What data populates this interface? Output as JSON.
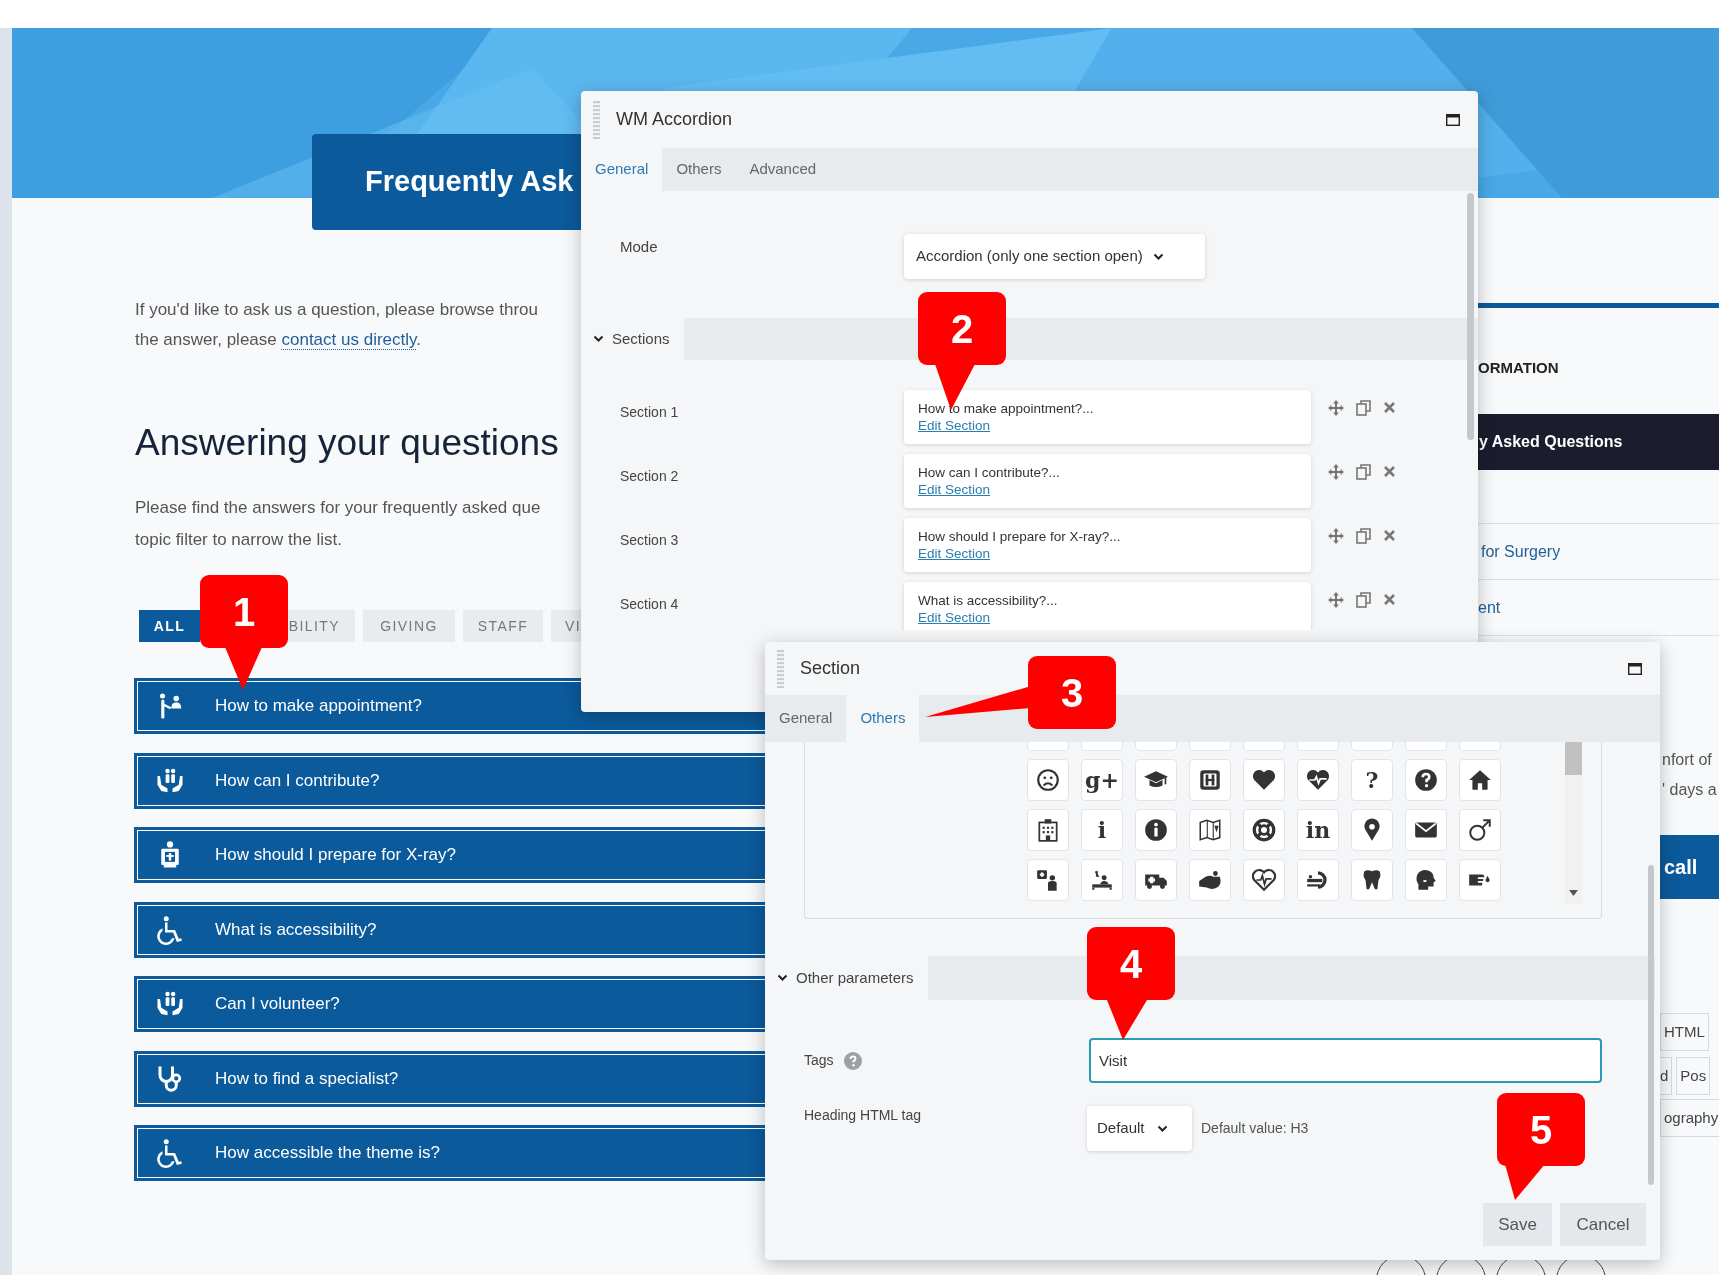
{
  "hero": {
    "title": "Frequently Ask"
  },
  "intro": {
    "line1": "If you'd like to ask us a question, please browse throu",
    "line2_start": "the answer, please ",
    "link": "contact us directly",
    "line2_end": "."
  },
  "heading": "Answering your questions",
  "description": {
    "lines": [
      "Please find the answers for your frequently asked que",
      "topic filter to narrow the list."
    ]
  },
  "filters": [
    {
      "label": "ALL",
      "selected": true
    },
    {
      "label": "BILITY",
      "selected": false
    },
    {
      "label": "GIVING",
      "selected": false
    },
    {
      "label": "STAFF",
      "selected": false
    },
    {
      "label": "VI",
      "selected": false
    }
  ],
  "faq": [
    {
      "question": "How to make appointment?"
    },
    {
      "question": "How can I contribute?"
    },
    {
      "question": "How should I prepare for X-ray?"
    },
    {
      "question": "What is accessibility?"
    },
    {
      "question": "Can I volunteer?"
    },
    {
      "question": "How to find a specialist?"
    },
    {
      "question": "How accessible the theme is?"
    }
  ],
  "sidebar": {
    "heading": "ORMATION",
    "active_item": "y Asked Questions",
    "links": [
      "for Surgery",
      "ent"
    ],
    "text_lines": [
      "nfort of",
      "' days a"
    ],
    "button": "call",
    "tags": [
      [
        "HTML"
      ],
      [
        "d",
        "Pos"
      ],
      [
        "ography"
      ]
    ]
  },
  "accordion_dialog": {
    "title": "WM Accordion",
    "tabs": [
      {
        "label": "General",
        "selected": true
      },
      {
        "label": "Others",
        "selected": false
      },
      {
        "label": "Advanced",
        "selected": false
      }
    ],
    "mode_label": "Mode",
    "mode_value": "Accordion (only one section open)",
    "group": "Sections",
    "sections": [
      {
        "label": "Section 1",
        "summary": "How to make appointment?...",
        "link": "Edit Section"
      },
      {
        "label": "Section 2",
        "summary": "How can I contribute?...",
        "link": "Edit Section"
      },
      {
        "label": "Section 3",
        "summary": "How should I prepare for X-ray?...",
        "link": "Edit Section"
      },
      {
        "label": "Section 4",
        "summary": "What is accessibility?...",
        "link": "Edit Section"
      }
    ]
  },
  "section_dialog": {
    "title": "Section",
    "tabs": [
      {
        "label": "General",
        "selected": false
      },
      {
        "label": "Others",
        "selected": true
      }
    ],
    "icon_picker": {
      "cells": [
        {
          "kind": "icon"
        },
        {
          "kind": "glyph",
          "text": "g+"
        },
        {
          "kind": "icon"
        },
        {
          "kind": "icon"
        },
        {
          "kind": "icon"
        },
        {
          "kind": "icon"
        },
        {
          "kind": "glyph",
          "text": "?"
        },
        {
          "kind": "icon"
        },
        {
          "kind": "icon"
        },
        {
          "kind": "icon"
        },
        {
          "kind": "glyph",
          "text": "i"
        },
        {
          "kind": "icon"
        },
        {
          "kind": "icon"
        },
        {
          "kind": "icon"
        },
        {
          "kind": "glyph",
          "text": "in"
        },
        {
          "kind": "icon"
        },
        {
          "kind": "icon"
        },
        {
          "kind": "icon"
        },
        {
          "kind": "icon"
        },
        {
          "kind": "icon"
        },
        {
          "kind": "icon"
        },
        {
          "kind": "icon"
        },
        {
          "kind": "icon"
        },
        {
          "kind": "icon"
        },
        {
          "kind": "icon"
        },
        {
          "kind": "icon"
        },
        {
          "kind": "icon"
        }
      ]
    },
    "group": "Other parameters",
    "tags_label": "Tags",
    "tags_value": "Visit",
    "heading_label": "Heading HTML tag",
    "heading_value": "Default",
    "heading_hint": "Default value: H3",
    "buttons": [
      "Save",
      "Cancel"
    ]
  },
  "callouts": [
    {
      "text": "1"
    },
    {
      "text": "2"
    },
    {
      "text": "3"
    },
    {
      "text": "4"
    },
    {
      "text": "5"
    }
  ]
}
